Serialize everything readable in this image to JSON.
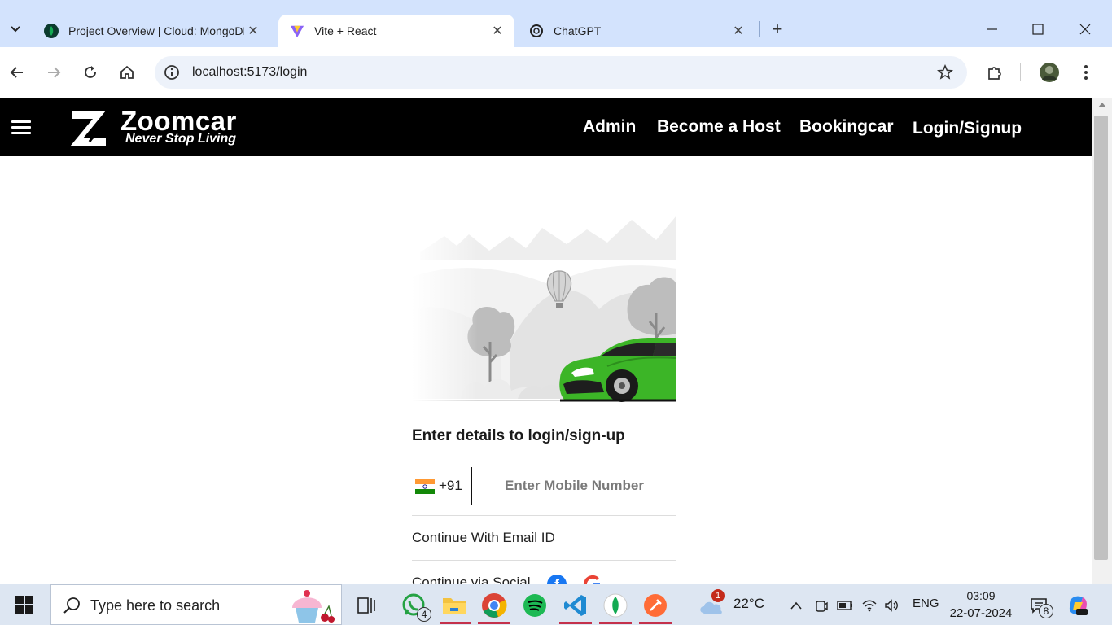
{
  "browser": {
    "tabs": [
      {
        "title": "Project Overview | Cloud: MongoDB Cloud",
        "active": false
      },
      {
        "title": "Vite + React",
        "active": true
      },
      {
        "title": "ChatGPT",
        "active": false
      }
    ],
    "url": "localhost:5173/login"
  },
  "site": {
    "brand": "Zoomcar",
    "tagline": "Never Stop Living",
    "nav": [
      "Admin",
      "Become a Host",
      "Bookingcar",
      "Login/Signup"
    ]
  },
  "login": {
    "heading": "Enter details to login/sign-up",
    "country_code": "+91",
    "mobile_placeholder": "Enter Mobile Number",
    "email_option": "Continue With Email ID",
    "social_option": "Continue via Social"
  },
  "taskbar": {
    "search_placeholder": "Type here to search",
    "whatsapp_badge": "4",
    "weather_badge": "1",
    "temperature": "22°C",
    "language": "ENG",
    "time": "03:09",
    "date": "22-07-2024",
    "notification_count": "8"
  },
  "colors": {
    "tab_strip": "#d3e3fd",
    "navbar": "#000000",
    "car_green": "#3cb527"
  }
}
